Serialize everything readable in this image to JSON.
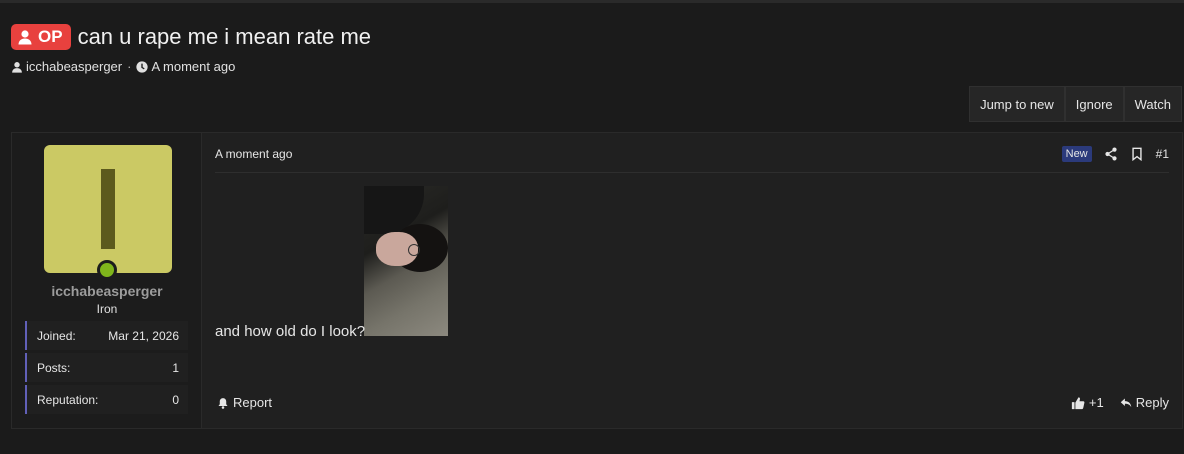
{
  "header": {
    "op_badge": "OP",
    "title": "can u rape me i mean rate me",
    "author": "icchabeasperger",
    "separator": "·",
    "time": "A moment ago"
  },
  "thread_buttons": [
    "Jump to new",
    "Ignore",
    "Watch"
  ],
  "user": {
    "avatar_letter": "I",
    "avatar_color": "#cbc964",
    "online_color": "#7fb51b",
    "username": "icchabeasperger",
    "rank": "Iron",
    "stats": [
      {
        "label": "Joined:",
        "value": "Mar 21, 2026"
      },
      {
        "label": "Posts:",
        "value": "1"
      },
      {
        "label": "Reputation:",
        "value": "0"
      }
    ]
  },
  "post": {
    "time": "A moment ago",
    "new_badge": "New",
    "number": "#1",
    "text": "and how old do I look?",
    "report_label": "Report",
    "like_count": "+1",
    "reply_label": "Reply"
  }
}
